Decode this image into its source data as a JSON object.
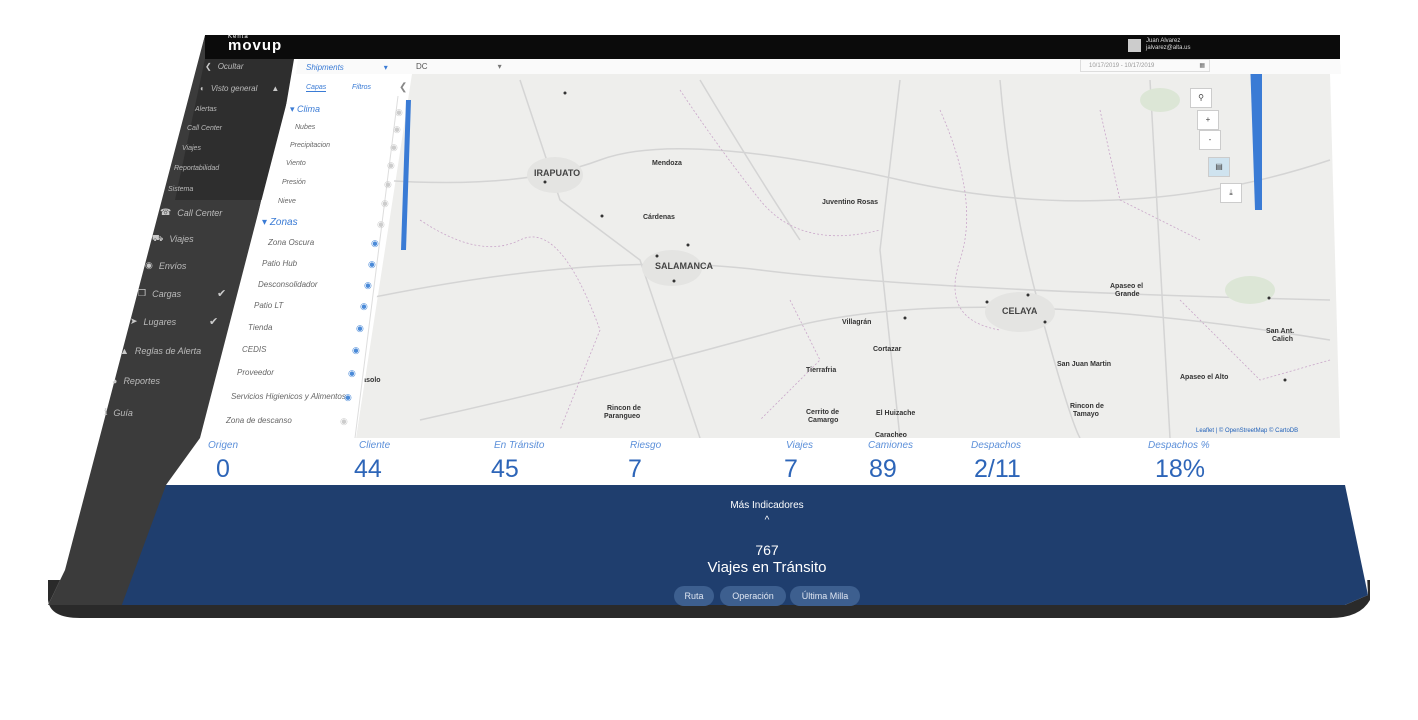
{
  "app": {
    "logo": "movup",
    "logo_small": "Kenta"
  },
  "user": {
    "name": "Juan Alvarez",
    "email": "jalvarez@alta.us"
  },
  "sidebar": {
    "items": [
      {
        "label": "Ocultar",
        "icon": "hide-icon"
      },
      {
        "label": "Visto general",
        "icon": "dashboard-icon"
      },
      {
        "label": "Alertas"
      },
      {
        "label": "Call Center"
      },
      {
        "label": "Viajes"
      },
      {
        "label": "Reportabilidad"
      },
      {
        "label": "Sistema"
      },
      {
        "label": "Call Center",
        "icon": "headset-icon"
      },
      {
        "label": "Viajes",
        "icon": "truck-icon"
      },
      {
        "label": "Envíos",
        "icon": "box-icon"
      },
      {
        "label": "Cargas",
        "icon": "cube-icon"
      },
      {
        "label": "Lugares",
        "icon": "pin-icon"
      },
      {
        "label": "Reglas de Alerta",
        "icon": "warning-icon"
      },
      {
        "label": "Reportes",
        "icon": "pie-chart-icon"
      },
      {
        "label": "Guía",
        "icon": "info-icon"
      }
    ]
  },
  "panel": {
    "selector": "Shipments",
    "tabs": [
      "Capas",
      "Filtros"
    ],
    "groups": {
      "clima": "Clima",
      "zonas": "Zonas"
    },
    "clima_items": [
      "Nubes",
      "Precipitacion",
      "Viento",
      "Presión",
      "Nieve"
    ],
    "zona_items": [
      "Zona Oscura",
      "Patio Hub",
      "Desconsolidador",
      "Patio LT",
      "Tienda",
      "CEDIS",
      "Proveedor",
      "Servicios Higienicos y Alimentos",
      "Zona de descanso"
    ]
  },
  "map": {
    "filter": "DC",
    "date_range": "10/17/2019 - 10/17/2019",
    "attribution": "Leaflet | © OpenStreetMap © CartoDB",
    "controls": [
      "search-icon",
      "zoom-in",
      "zoom-out",
      "layers-icon",
      "download-icon"
    ],
    "zoom_in": "+",
    "zoom_out": "-",
    "places": [
      "IRAPUATO",
      "Mendoza",
      "Juventino Rosas",
      "Cárdenas",
      "SALAMANCA",
      "CELAYA",
      "Apaseo el Grande",
      "Villagrán",
      "Cortazar",
      "San Juan Martin",
      "San Ant. Calich",
      "Apaseo el Alto",
      "Tierrafria",
      "Rincon de Parangueo",
      "Cerrito de Camargo",
      "El Huizache",
      "Caracheo",
      "Rincon de Tamayo",
      "basolo"
    ]
  },
  "kpis": [
    {
      "label": "Origen",
      "value": "0"
    },
    {
      "label": "Cliente",
      "value": "44"
    },
    {
      "label": "En Tránsito",
      "value": "45"
    },
    {
      "label": "Riesgo",
      "value": "7"
    },
    {
      "label": "Viajes",
      "value": "7"
    },
    {
      "label": "Camiones",
      "value": "89"
    },
    {
      "label": "Despachos",
      "value": "2/11"
    },
    {
      "label": "Despachos %",
      "value": "18%"
    }
  ],
  "footer": {
    "more": "Más Indicadores",
    "caret": "^",
    "count": "767",
    "count_label": "Viajes en Tránsito",
    "buttons": [
      "Ruta",
      "Operación",
      "Última Milla"
    ]
  },
  "colors": {
    "accent": "#3a7bd5",
    "footer": "#1f3e6e",
    "sidebar": "#3c3c3c"
  }
}
